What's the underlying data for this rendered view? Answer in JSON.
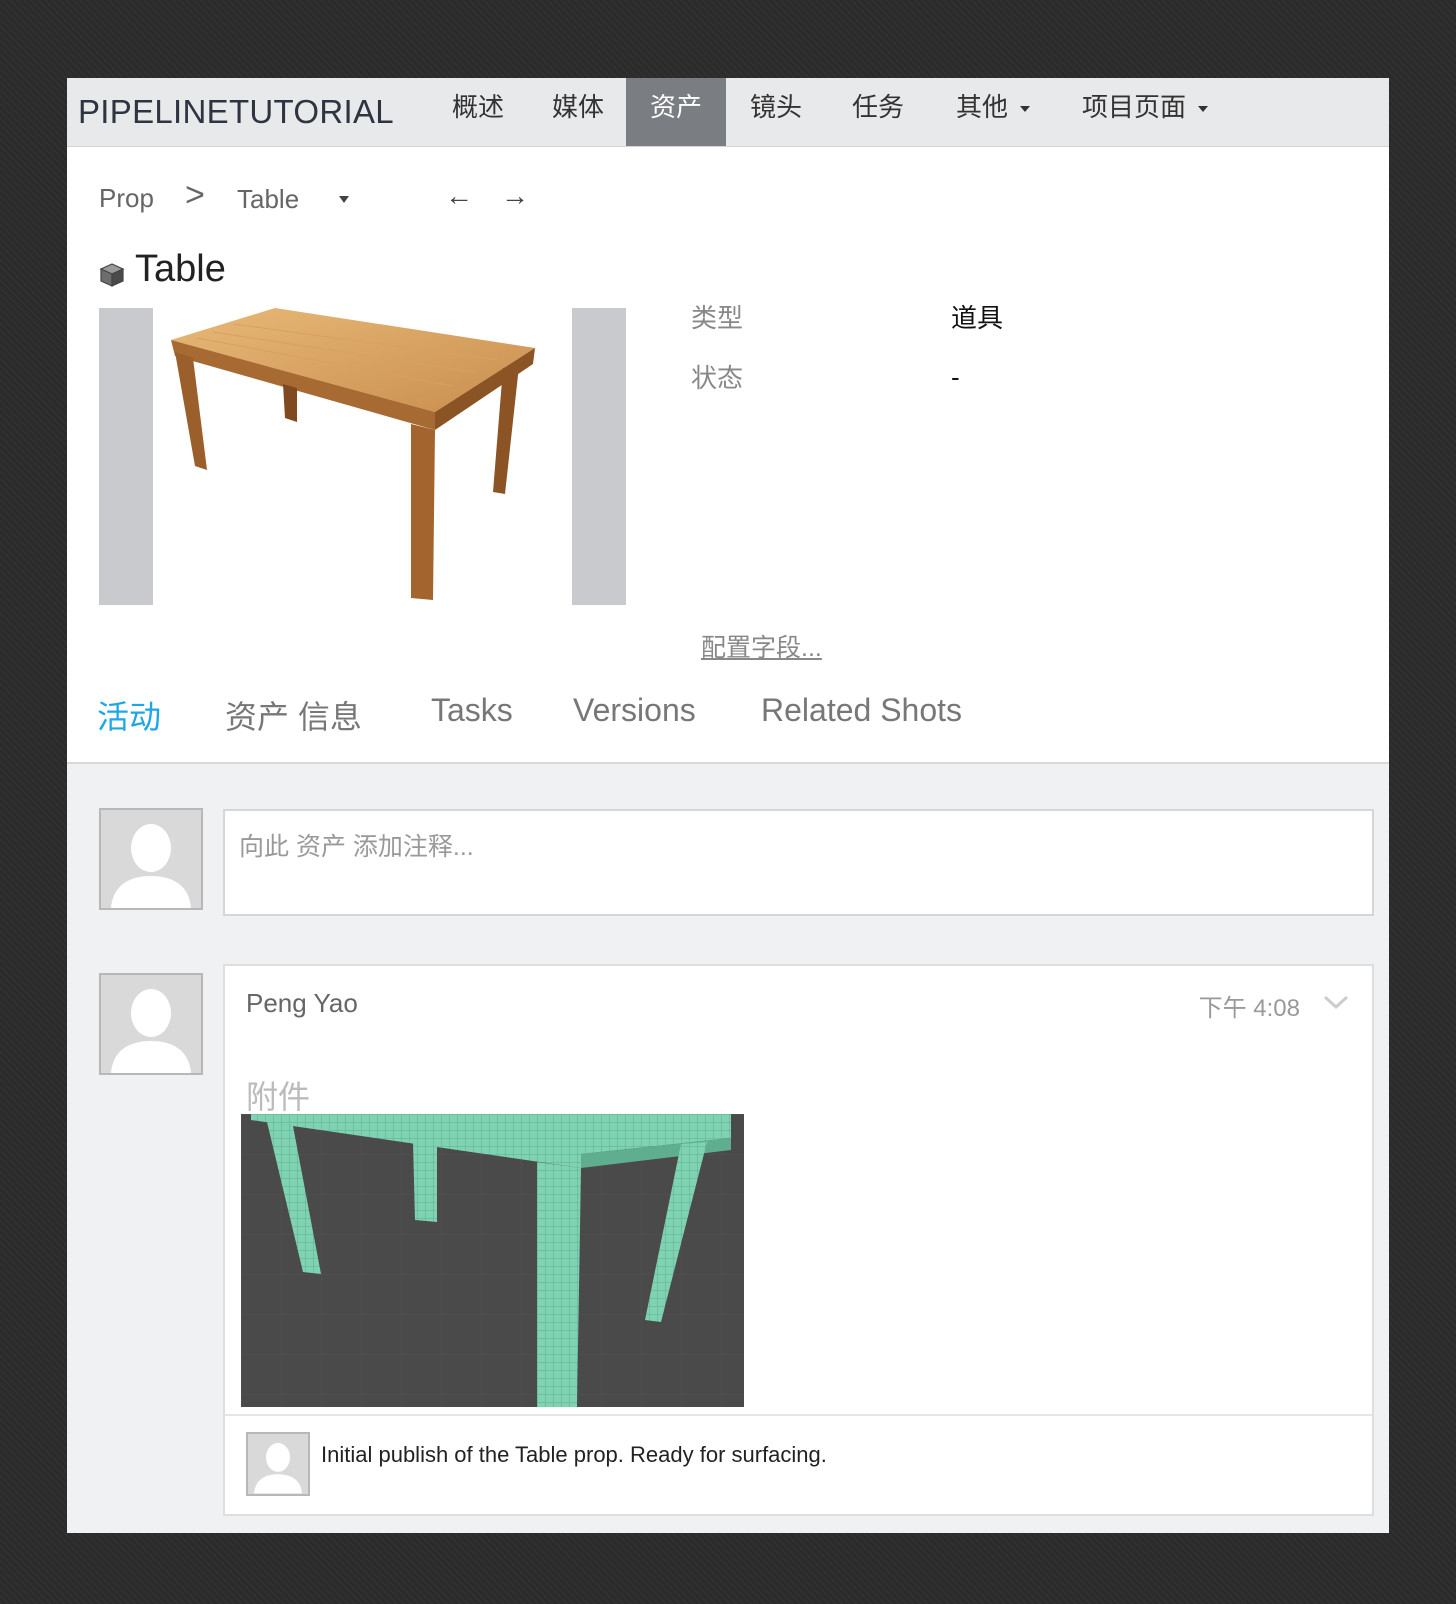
{
  "navbar": {
    "brand": "PIPELINETUTORIAL",
    "items": [
      {
        "label": "概述",
        "active": false,
        "dropdown": false
      },
      {
        "label": "媒体",
        "active": false,
        "dropdown": false
      },
      {
        "label": "资产",
        "active": true,
        "dropdown": false
      },
      {
        "label": "镜头",
        "active": false,
        "dropdown": false
      },
      {
        "label": "任务",
        "active": false,
        "dropdown": false
      },
      {
        "label": "其他",
        "active": false,
        "dropdown": true
      },
      {
        "label": "项目页面",
        "active": false,
        "dropdown": true
      }
    ]
  },
  "breadcrumb": {
    "parent": "Prop",
    "separator": ">",
    "current": "Table",
    "prev_icon": "arrow-left-icon",
    "next_icon": "arrow-right-icon"
  },
  "asset": {
    "icon": "cube-icon",
    "title": "Table",
    "thumbnail": "wooden-table-photo"
  },
  "fields": [
    {
      "label": "类型",
      "value": "道具"
    },
    {
      "label": "状态",
      "value": "-"
    }
  ],
  "config_link": "配置字段...",
  "tabs": [
    {
      "label": "活动",
      "active": true
    },
    {
      "label": "资产 信息",
      "active": false
    },
    {
      "label": "Tasks",
      "active": false
    },
    {
      "label": "Versions",
      "active": false
    },
    {
      "label": "Related Shots",
      "active": false
    }
  ],
  "note_input": {
    "placeholder": "向此 资产 添加注释..."
  },
  "activity": {
    "author": "Peng Yao",
    "time": "下午 4:08",
    "attachments_label": "附件",
    "attachment": "table-wireframe-render",
    "comment": "Initial publish of the Table prop. Ready for surfacing."
  },
  "colors": {
    "accent": "#1ea7e4",
    "nav_active": "#7a7d82",
    "navbar_bg": "#e8e9eb",
    "activity_bg": "#f0f1f3"
  }
}
